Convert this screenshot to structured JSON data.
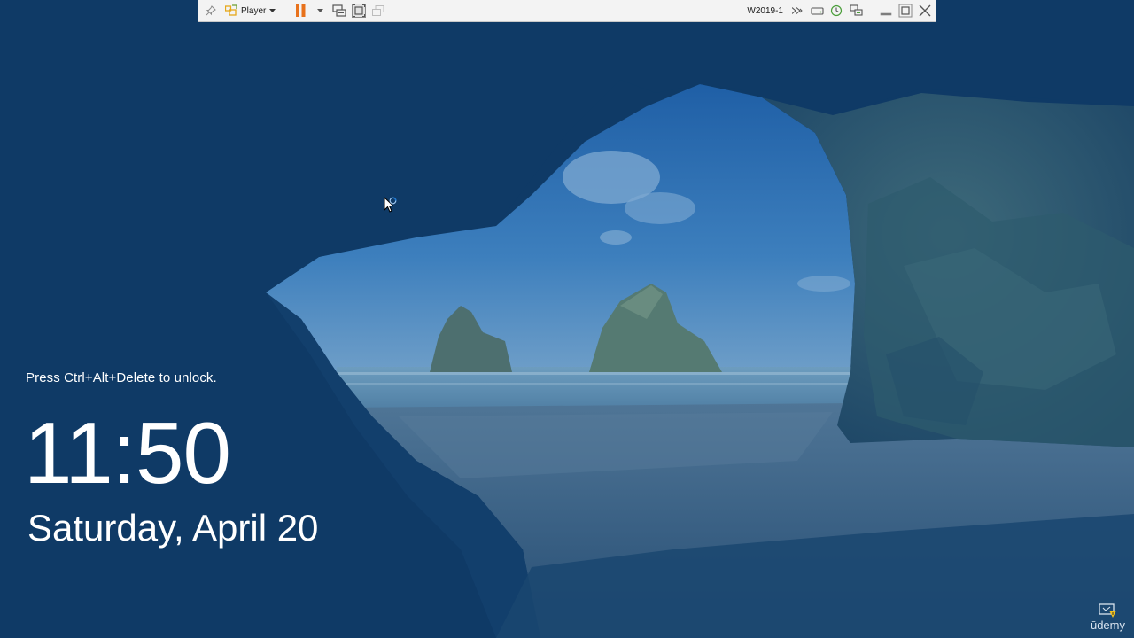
{
  "vm_toolbar": {
    "player_label": "Player",
    "vm_name": "W2019-1"
  },
  "lock_screen": {
    "unlock_hint": "Press Ctrl+Alt+Delete to unlock.",
    "time": "11:50",
    "date": "Saturday, April 20"
  },
  "watermark": {
    "text": "ūdemy"
  },
  "colors": {
    "background": "#0f3a66",
    "toolbar_bg": "#f3f3f3",
    "pause_orange": "#e8721c",
    "text_white": "#ffffff"
  },
  "icons": {
    "pin": "pin-icon",
    "player_logo": "player-logo-icon",
    "pause": "pause-icon",
    "send_keys": "send-ctrl-alt-del-icon",
    "fullscreen": "fullscreen-icon",
    "unity": "unity-icon",
    "more": "double-chevron-icon",
    "drive": "drive-icon",
    "network": "network-icon",
    "display": "display-icon",
    "minimize": "minimize-icon",
    "restore": "restore-icon",
    "close": "close-icon"
  }
}
